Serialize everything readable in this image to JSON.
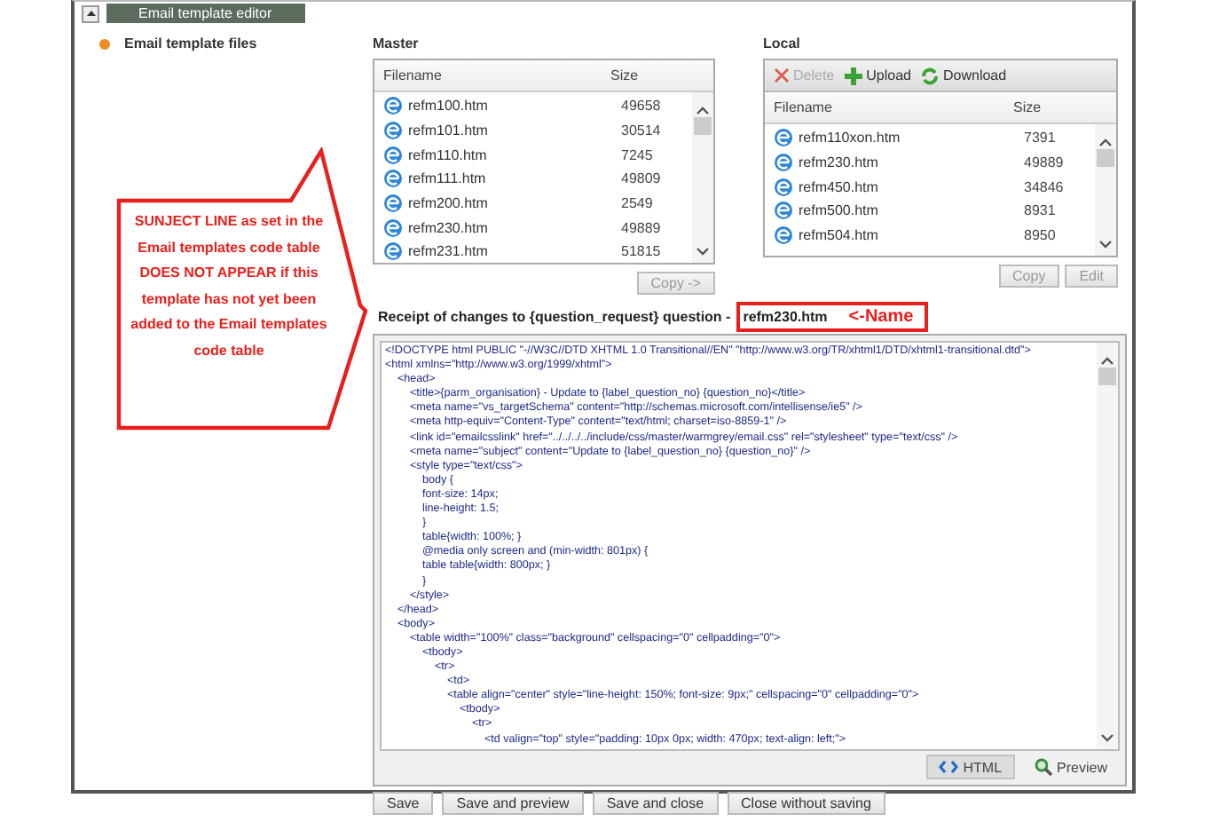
{
  "header": {
    "title": "Email template editor",
    "expanded": true
  },
  "sidebar": {
    "items": [
      {
        "label": "Email template files",
        "selected": true
      }
    ]
  },
  "master": {
    "title": "Master",
    "columns": [
      "Filename",
      "Size"
    ],
    "rows": [
      {
        "filename": "refm100.htm",
        "size": "49658"
      },
      {
        "filename": "refm101.htm",
        "size": "30514"
      },
      {
        "filename": "refm110.htm",
        "size": "7245"
      },
      {
        "filename": "refm111.htm",
        "size": "49809"
      },
      {
        "filename": "refm200.htm",
        "size": "2549"
      },
      {
        "filename": "refm230.htm",
        "size": "49889"
      },
      {
        "filename": "refm231.htm",
        "size": "51815"
      }
    ],
    "buttons": [
      {
        "label": "Copy ->",
        "disabled": true
      }
    ]
  },
  "local": {
    "title": "Local",
    "toolbar": [
      {
        "label": "Delete",
        "kind": "delete",
        "disabled": true
      },
      {
        "label": "Upload",
        "kind": "upload",
        "disabled": false
      },
      {
        "label": "Download",
        "kind": "download",
        "disabled": false
      }
    ],
    "columns": [
      "Filename",
      "Size"
    ],
    "rows": [
      {
        "filename": "refm110xon.htm",
        "size": "7391"
      },
      {
        "filename": "refm230.htm",
        "size": "49889"
      },
      {
        "filename": "refm450.htm",
        "size": "34846"
      },
      {
        "filename": "refm500.htm",
        "size": "8931"
      },
      {
        "filename": "refm504.htm",
        "size": "8950"
      }
    ],
    "buttons": [
      {
        "label": "Copy",
        "disabled": true
      },
      {
        "label": "Edit",
        "disabled": true
      }
    ]
  },
  "editor": {
    "title": "Receipt of changes to {question_request} question -",
    "file_name": "refm230.htm",
    "name_note": "<-Name",
    "code": [
      "<!DOCTYPE html PUBLIC \"-//W3C//DTD XHTML 1.0 Transitional//EN\" \"http://www.w3.org/TR/xhtml1/DTD/xhtml1-transitional.dtd\">",
      "<html xmlns=\"http://www.w3.org/1999/xhtml\">",
      "    <head>",
      "        <title>{parm_organisation} - Update to {label_question_no} {question_no}</title>",
      "        <meta name=\"vs_targetSchema\" content=\"http://schemas.microsoft.com/intellisense/ie5\" />",
      "        <meta http-equiv=\"Content-Type\" content=\"text/html; charset=iso-8859-1\" />",
      "        <link id=\"emailcsslink\" href=\"../../../../include/css/master/warmgrey/email.css\" rel=\"stylesheet\" type=\"text/css\" />",
      "        <meta name=\"subject\" content=\"Update to {label_question_no} {question_no}\" />",
      "        <style type=\"text/css\">",
      "            body {",
      "            font-size: 14px;",
      "            line-height: 1.5;",
      "            }",
      "            table{width: 100%; }",
      "            @media only screen and (min-width: 801px) {",
      "            table table{width: 800px; }",
      "            }",
      "        </style>",
      "    </head>",
      "    <body>",
      "        <table width=\"100%\" class=\"background\" cellspacing=\"0\" cellpadding=\"0\">",
      "            <tbody>",
      "                <tr>",
      "                    <td>",
      "                    <table align=\"center\" style=\"line-height: 150%; font-size: 9px;\" cellspacing=\"0\" cellpadding=\"0\">",
      "                        <tbody>",
      "                            <tr>",
      "                                <td valign=\"top\" style=\"padding: 10px 0px; width: 470px; text-align: left;\">"
    ],
    "tabs": [
      {
        "label": "HTML",
        "kind": "code",
        "selected": true
      },
      {
        "label": "Preview",
        "kind": "preview",
        "selected": false
      }
    ]
  },
  "actions": [
    "Save",
    "Save and preview",
    "Save and close",
    "Close without saving"
  ],
  "callout": {
    "text": "SUNJECT LINE as set in the Email templates code table DOES NOT APPEAR if this template has not yet been added to the Email templates code table"
  }
}
